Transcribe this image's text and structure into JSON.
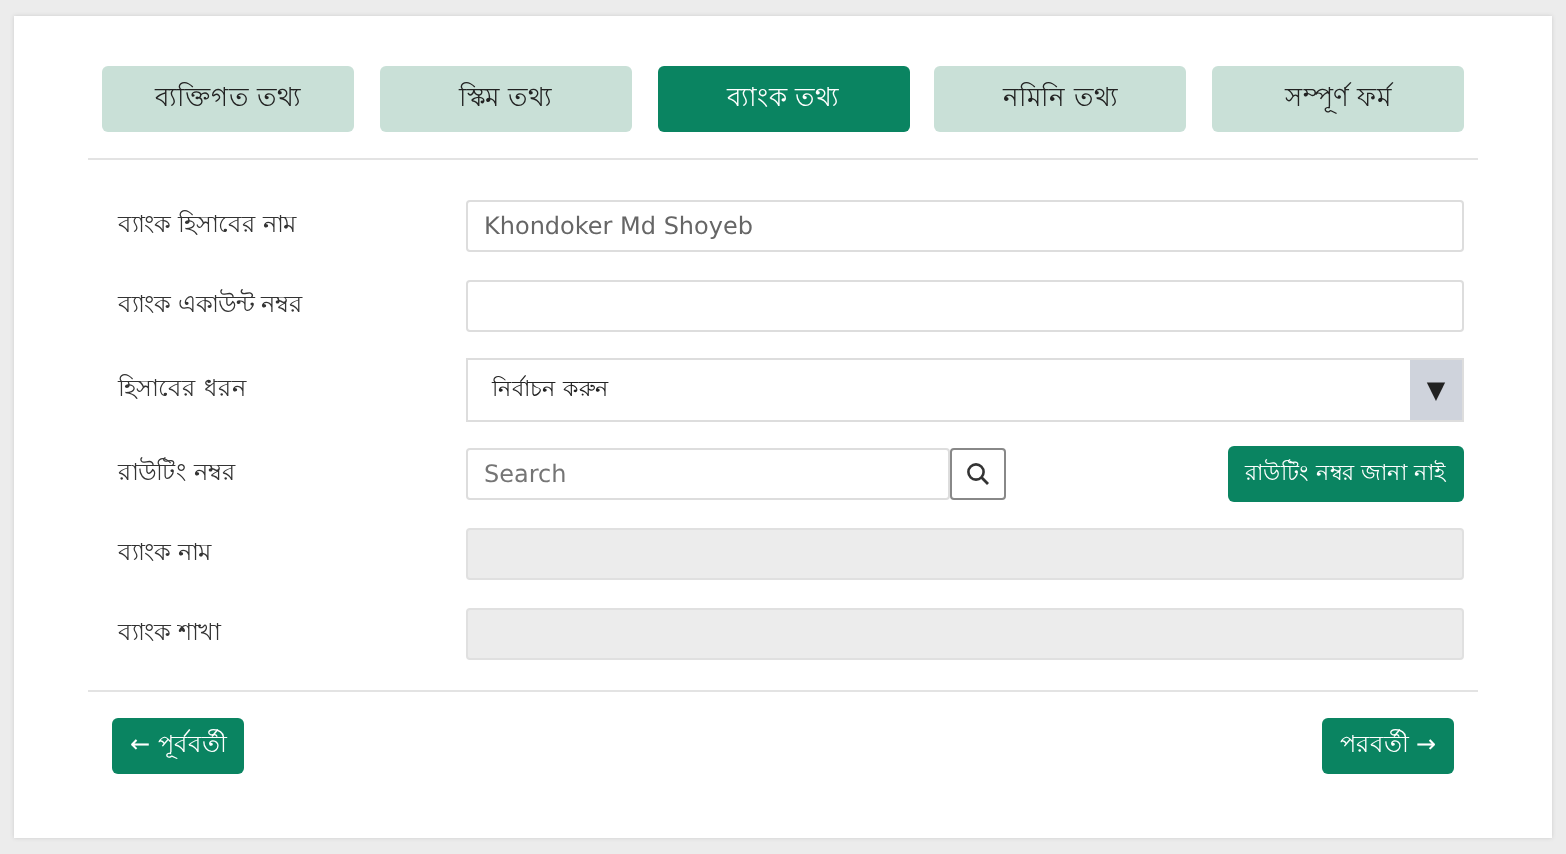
{
  "tabs": [
    {
      "label": "ব্যক্তিগত তথ্য",
      "selected": false
    },
    {
      "label": "স্কিম তথ্য",
      "selected": false
    },
    {
      "label": "ব্যাংক তথ্য",
      "selected": true
    },
    {
      "label": "নমিনি তথ্য",
      "selected": false
    },
    {
      "label": "সম্পূর্ণ ফর্ম",
      "selected": false
    }
  ],
  "fields": [
    {
      "label": "ব্যাংক হিসাবের নাম",
      "kind": "text",
      "value": "Khondoker Md Shoyeb"
    },
    {
      "label": "ব্যাংক একাউন্ট নম্বর",
      "kind": "text"
    },
    {
      "label": "হিসাবের ধরন",
      "kind": "select",
      "value": "নির্বাচন করুন",
      "arrow": "▼"
    },
    {
      "label": "রাউটিং নম্বর",
      "kind": "search",
      "placeholder": "Search",
      "action": "রাউটিং নম্বর জানা নাই"
    },
    {
      "label": "ব্যাংক নাম",
      "kind": "disabled"
    },
    {
      "label": "ব্যাংক শাখা",
      "kind": "disabled"
    }
  ],
  "nav": {
    "previous": "← পূর্ববর্তী",
    "next": "পরবর্তী →"
  }
}
